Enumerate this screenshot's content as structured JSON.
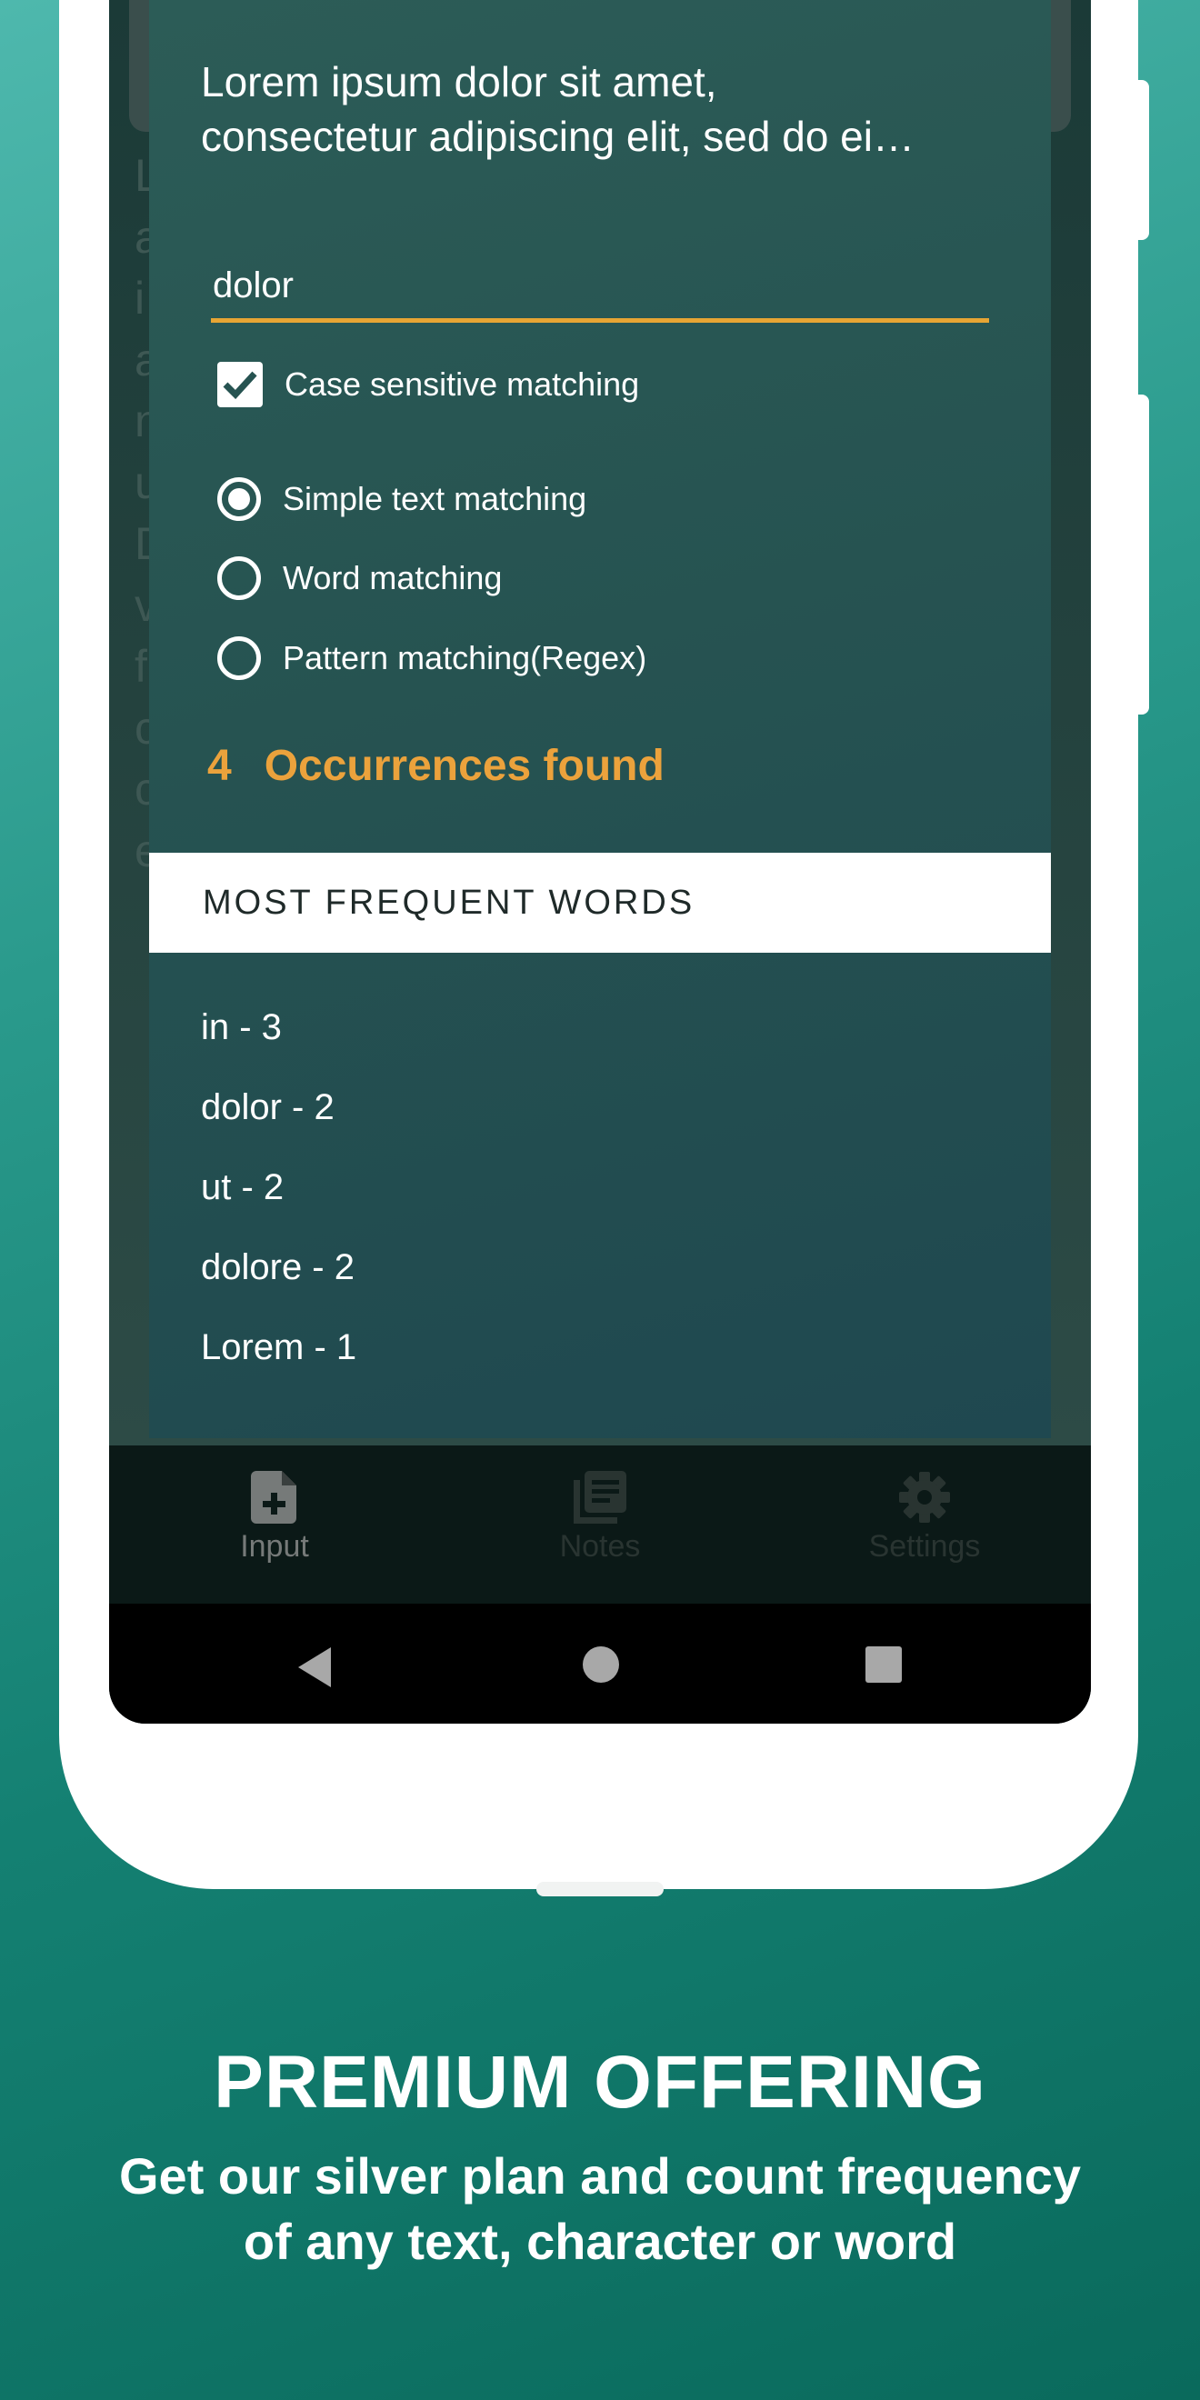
{
  "dialog": {
    "preview_lines": [
      "Lorem ipsum dolor sit amet,",
      "consectetur adipiscing elit, sed do ei…"
    ],
    "search_value": "dolor",
    "case_sensitive_label": "Case sensitive matching",
    "case_sensitive_checked": true,
    "match_modes": [
      {
        "label": "Simple text matching",
        "selected": true
      },
      {
        "label": "Word matching",
        "selected": false
      },
      {
        "label": "Pattern matching(Regex)",
        "selected": false
      }
    ],
    "occurrences_count": "4",
    "occurrences_label": "Occurrences found",
    "frequent_header": "MOST FREQUENT WORDS",
    "frequent_words": [
      "in - 3",
      "dolor - 2",
      "ut - 2",
      "dolore - 2",
      "Lorem - 1"
    ]
  },
  "background_text_lines": [
    "L",
    "a",
    "i",
    "a",
    "n",
    "u",
    "D",
    "v",
    "f",
    "c",
    "c",
    "e"
  ],
  "nav": {
    "items": [
      {
        "label": "Input",
        "icon": "note-add-icon",
        "active": true
      },
      {
        "label": "Notes",
        "icon": "library-books-icon",
        "active": false
      },
      {
        "label": "Settings",
        "icon": "gear-icon",
        "active": false
      }
    ]
  },
  "system_nav": {
    "back": "back-icon",
    "home": "home-icon",
    "recents": "recents-icon"
  },
  "promo": {
    "title": "PREMIUM OFFERING",
    "subtitle_lines": [
      "Get our silver plan and count frequency",
      "of any text, character or word"
    ]
  },
  "colors": {
    "accent": "#e7a534",
    "dialog_bg": "#265351",
    "page_bg": "#1a8a7c"
  }
}
